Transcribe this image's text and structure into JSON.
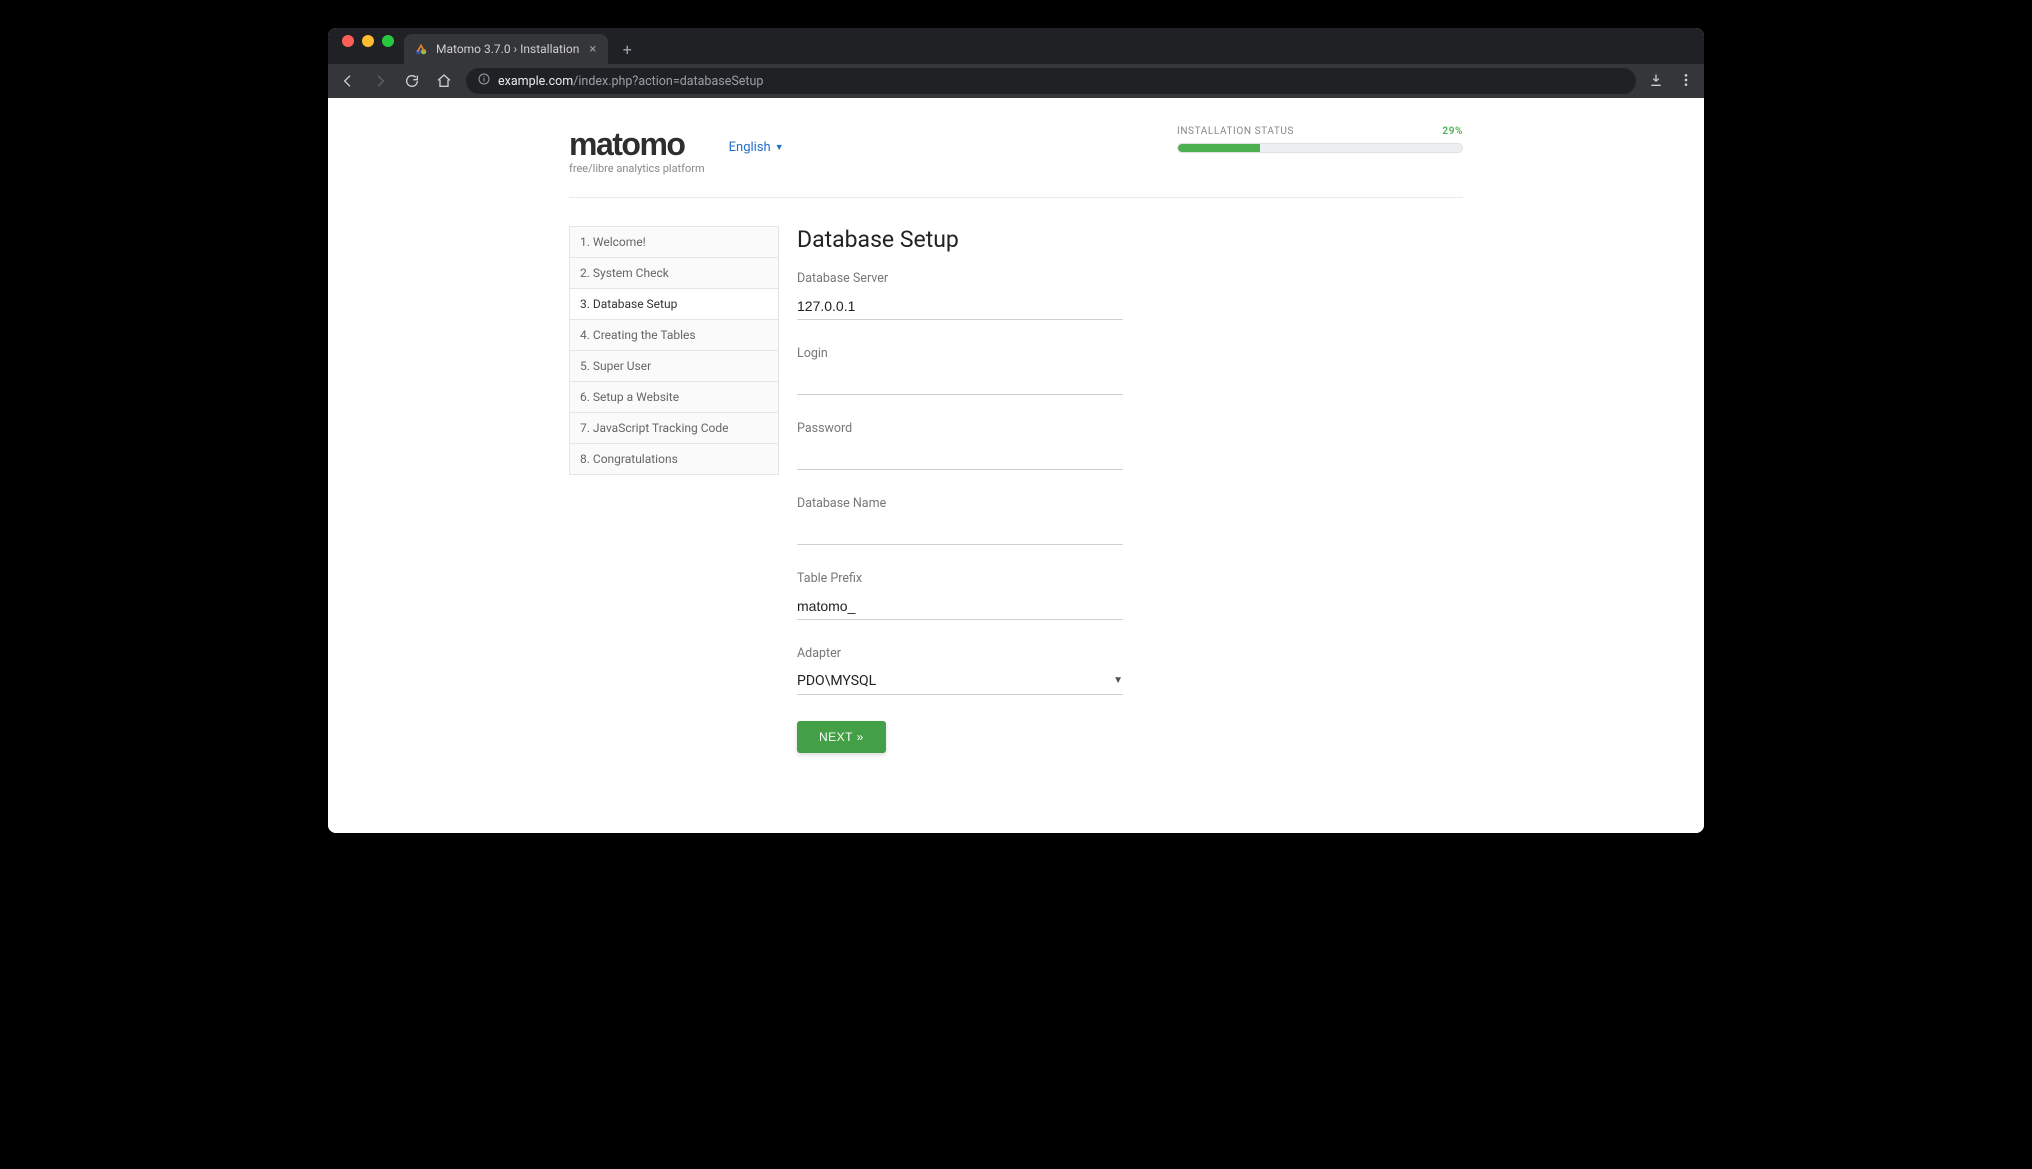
{
  "browser": {
    "tab_title": "Matomo 3.7.0 › Installation",
    "url_host": "example.com",
    "url_path": "/index.php?action=databaseSetup"
  },
  "brand": {
    "logo_text": "matomo",
    "tagline": "free/libre analytics platform"
  },
  "language": {
    "label": "English"
  },
  "status": {
    "label": "INSTALLATION STATUS",
    "percent_text": "29%",
    "percent_value": 29
  },
  "steps": [
    {
      "label": "1. Welcome!",
      "active": false
    },
    {
      "label": "2. System Check",
      "active": false
    },
    {
      "label": "3. Database Setup",
      "active": true
    },
    {
      "label": "4. Creating the Tables",
      "active": false
    },
    {
      "label": "5. Super User",
      "active": false
    },
    {
      "label": "6. Setup a Website",
      "active": false
    },
    {
      "label": "7. JavaScript Tracking Code",
      "active": false
    },
    {
      "label": "8. Congratulations",
      "active": false
    }
  ],
  "page_title": "Database Setup",
  "form": {
    "db_server": {
      "label": "Database Server",
      "value": "127.0.0.1"
    },
    "login": {
      "label": "Login",
      "value": ""
    },
    "password": {
      "label": "Password",
      "value": ""
    },
    "db_name": {
      "label": "Database Name",
      "value": ""
    },
    "prefix": {
      "label": "Table Prefix",
      "value": "matomo_"
    },
    "adapter": {
      "label": "Adapter",
      "value": "PDO\\MYSQL"
    },
    "next_label": "NEXT »"
  }
}
